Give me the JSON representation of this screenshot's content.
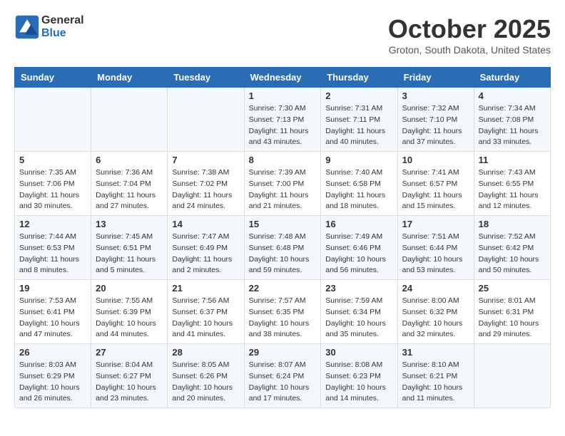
{
  "header": {
    "logo_general": "General",
    "logo_blue": "Blue",
    "month_title": "October 2025",
    "location": "Groton, South Dakota, United States"
  },
  "weekdays": [
    "Sunday",
    "Monday",
    "Tuesday",
    "Wednesday",
    "Thursday",
    "Friday",
    "Saturday"
  ],
  "weeks": [
    [
      {
        "day": "",
        "info": ""
      },
      {
        "day": "",
        "info": ""
      },
      {
        "day": "",
        "info": ""
      },
      {
        "day": "1",
        "info": "Sunrise: 7:30 AM\nSunset: 7:13 PM\nDaylight: 11 hours\nand 43 minutes."
      },
      {
        "day": "2",
        "info": "Sunrise: 7:31 AM\nSunset: 7:11 PM\nDaylight: 11 hours\nand 40 minutes."
      },
      {
        "day": "3",
        "info": "Sunrise: 7:32 AM\nSunset: 7:10 PM\nDaylight: 11 hours\nand 37 minutes."
      },
      {
        "day": "4",
        "info": "Sunrise: 7:34 AM\nSunset: 7:08 PM\nDaylight: 11 hours\nand 33 minutes."
      }
    ],
    [
      {
        "day": "5",
        "info": "Sunrise: 7:35 AM\nSunset: 7:06 PM\nDaylight: 11 hours\nand 30 minutes."
      },
      {
        "day": "6",
        "info": "Sunrise: 7:36 AM\nSunset: 7:04 PM\nDaylight: 11 hours\nand 27 minutes."
      },
      {
        "day": "7",
        "info": "Sunrise: 7:38 AM\nSunset: 7:02 PM\nDaylight: 11 hours\nand 24 minutes."
      },
      {
        "day": "8",
        "info": "Sunrise: 7:39 AM\nSunset: 7:00 PM\nDaylight: 11 hours\nand 21 minutes."
      },
      {
        "day": "9",
        "info": "Sunrise: 7:40 AM\nSunset: 6:58 PM\nDaylight: 11 hours\nand 18 minutes."
      },
      {
        "day": "10",
        "info": "Sunrise: 7:41 AM\nSunset: 6:57 PM\nDaylight: 11 hours\nand 15 minutes."
      },
      {
        "day": "11",
        "info": "Sunrise: 7:43 AM\nSunset: 6:55 PM\nDaylight: 11 hours\nand 12 minutes."
      }
    ],
    [
      {
        "day": "12",
        "info": "Sunrise: 7:44 AM\nSunset: 6:53 PM\nDaylight: 11 hours\nand 8 minutes."
      },
      {
        "day": "13",
        "info": "Sunrise: 7:45 AM\nSunset: 6:51 PM\nDaylight: 11 hours\nand 5 minutes."
      },
      {
        "day": "14",
        "info": "Sunrise: 7:47 AM\nSunset: 6:49 PM\nDaylight: 11 hours\nand 2 minutes."
      },
      {
        "day": "15",
        "info": "Sunrise: 7:48 AM\nSunset: 6:48 PM\nDaylight: 10 hours\nand 59 minutes."
      },
      {
        "day": "16",
        "info": "Sunrise: 7:49 AM\nSunset: 6:46 PM\nDaylight: 10 hours\nand 56 minutes."
      },
      {
        "day": "17",
        "info": "Sunrise: 7:51 AM\nSunset: 6:44 PM\nDaylight: 10 hours\nand 53 minutes."
      },
      {
        "day": "18",
        "info": "Sunrise: 7:52 AM\nSunset: 6:42 PM\nDaylight: 10 hours\nand 50 minutes."
      }
    ],
    [
      {
        "day": "19",
        "info": "Sunrise: 7:53 AM\nSunset: 6:41 PM\nDaylight: 10 hours\nand 47 minutes."
      },
      {
        "day": "20",
        "info": "Sunrise: 7:55 AM\nSunset: 6:39 PM\nDaylight: 10 hours\nand 44 minutes."
      },
      {
        "day": "21",
        "info": "Sunrise: 7:56 AM\nSunset: 6:37 PM\nDaylight: 10 hours\nand 41 minutes."
      },
      {
        "day": "22",
        "info": "Sunrise: 7:57 AM\nSunset: 6:35 PM\nDaylight: 10 hours\nand 38 minutes."
      },
      {
        "day": "23",
        "info": "Sunrise: 7:59 AM\nSunset: 6:34 PM\nDaylight: 10 hours\nand 35 minutes."
      },
      {
        "day": "24",
        "info": "Sunrise: 8:00 AM\nSunset: 6:32 PM\nDaylight: 10 hours\nand 32 minutes."
      },
      {
        "day": "25",
        "info": "Sunrise: 8:01 AM\nSunset: 6:31 PM\nDaylight: 10 hours\nand 29 minutes."
      }
    ],
    [
      {
        "day": "26",
        "info": "Sunrise: 8:03 AM\nSunset: 6:29 PM\nDaylight: 10 hours\nand 26 minutes."
      },
      {
        "day": "27",
        "info": "Sunrise: 8:04 AM\nSunset: 6:27 PM\nDaylight: 10 hours\nand 23 minutes."
      },
      {
        "day": "28",
        "info": "Sunrise: 8:05 AM\nSunset: 6:26 PM\nDaylight: 10 hours\nand 20 minutes."
      },
      {
        "day": "29",
        "info": "Sunrise: 8:07 AM\nSunset: 6:24 PM\nDaylight: 10 hours\nand 17 minutes."
      },
      {
        "day": "30",
        "info": "Sunrise: 8:08 AM\nSunset: 6:23 PM\nDaylight: 10 hours\nand 14 minutes."
      },
      {
        "day": "31",
        "info": "Sunrise: 8:10 AM\nSunset: 6:21 PM\nDaylight: 10 hours\nand 11 minutes."
      },
      {
        "day": "",
        "info": ""
      }
    ]
  ]
}
